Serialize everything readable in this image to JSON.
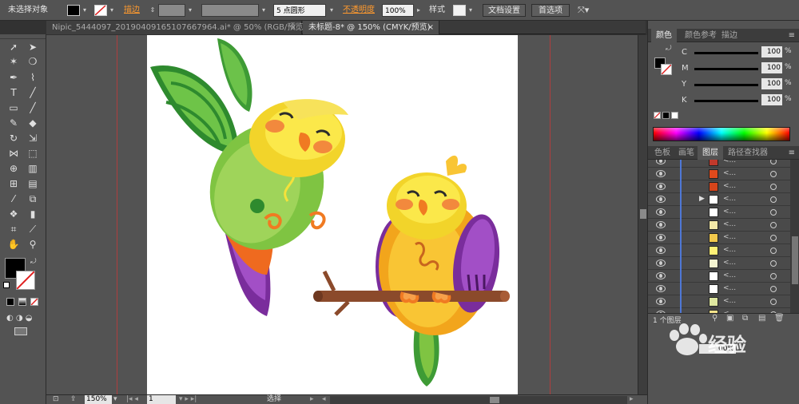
{
  "control_bar": {
    "selection_status": "未选择对象",
    "stroke_label": "描边",
    "brush_label": "5 点圆形",
    "opacity_label": "不透明度",
    "opacity_value": "100%",
    "style_label": "样式",
    "doc_setup_button": "文档设置",
    "prefs_button": "首选项",
    "colors": {
      "fill": "#000000",
      "accent_label": "#ff9a2e"
    }
  },
  "document_tabs": [
    {
      "label": "Nipic_5444097_20190409165107667964.ai* @ 50% (RGB/预览)",
      "close": "×"
    },
    {
      "label": "未标题-8* @ 150% (CMYK/预览)",
      "close": "×"
    }
  ],
  "color_panel": {
    "tabs": [
      "颜色",
      "颜色参考",
      "描边"
    ],
    "channels": [
      {
        "label": "C",
        "value": "100",
        "unit": "%"
      },
      {
        "label": "M",
        "value": "100",
        "unit": "%"
      },
      {
        "label": "Y",
        "value": "100",
        "unit": "%"
      },
      {
        "label": "K",
        "value": "100",
        "unit": "%"
      }
    ]
  },
  "layers_panel": {
    "tabs": [
      "色板",
      "画笔",
      "图层",
      "路径查找器"
    ],
    "rows": [
      {
        "name": "<...",
        "swatch": "#c0392b"
      },
      {
        "name": "<...",
        "swatch": "#e04a1c"
      },
      {
        "name": "<...",
        "swatch": "#d6451b"
      },
      {
        "name": "<...",
        "swatch": "#ffffff"
      },
      {
        "name": "<...",
        "swatch": "#ffffff"
      },
      {
        "name": "<...",
        "swatch": "#f3e9a8"
      },
      {
        "name": "<...",
        "swatch": "#f2c94c"
      },
      {
        "name": "<...",
        "swatch": "#fff176"
      },
      {
        "name": "<...",
        "swatch": "#f4f4d0"
      },
      {
        "name": "<...",
        "swatch": "#ffffff"
      },
      {
        "name": "<...",
        "swatch": "#ffffff"
      },
      {
        "name": "<...",
        "swatch": "#dfe8a0"
      },
      {
        "name": "<...",
        "swatch": "#f7e38a"
      }
    ],
    "footer_text": "1 个图层"
  },
  "status_bar": {
    "zoom": "150%",
    "page": "1",
    "mode": "选择"
  },
  "watermark_text": "经验",
  "watermark_field": "00%"
}
